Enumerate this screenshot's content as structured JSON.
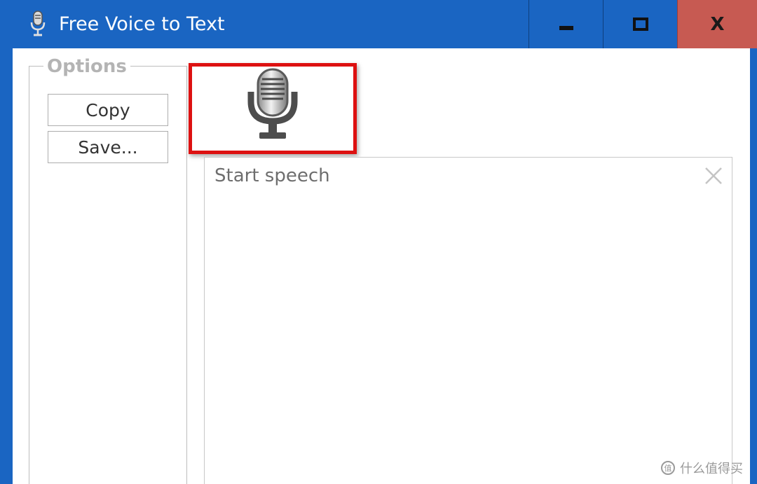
{
  "window": {
    "title": "Free Voice to Text",
    "controls": {
      "minimize_icon": "minimize-icon",
      "maximize_icon": "maximize-icon",
      "close_label": "X"
    },
    "colors": {
      "titlebar": "#1a65c2",
      "close": "#c75a52",
      "highlight_border": "#dd1111"
    }
  },
  "options": {
    "legend": "Options",
    "copy_label": "Copy",
    "save_label": "Save..."
  },
  "speech": {
    "microphone_icon": "microphone-icon",
    "placeholder": "Start speech",
    "clear_icon": "close-icon"
  },
  "watermark": {
    "text": "什么值得买"
  }
}
